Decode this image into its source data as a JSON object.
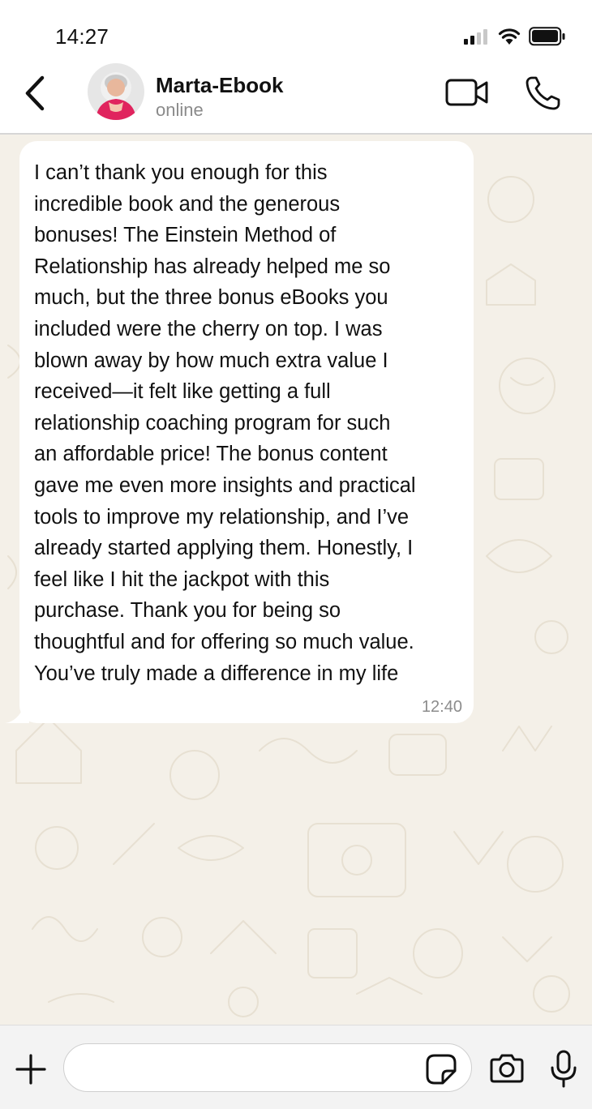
{
  "status_bar": {
    "time": "14:27",
    "icons": [
      "signal-icon",
      "wifi-icon",
      "battery-icon"
    ]
  },
  "header": {
    "back_icon": "chevron-left-icon",
    "contact_name": "Marta-Ebook",
    "contact_status": "online",
    "actions": [
      "video-camera-icon",
      "phone-icon"
    ]
  },
  "chat": {
    "wallpaper_color": "#f4f0e8",
    "messages": [
      {
        "direction": "incoming",
        "text": "I can’t thank you enough for this\nincredible book and the generous\nbonuses! The Einstein Method of\nRelationship has already helped me so\nmuch, but the three bonus eBooks you\nincluded were the cherry on top. I was\nblown away by how much extra value I\nreceived—it felt like getting a full\nrelationship coaching program for such\nan affordable price! The bonus content\ngave me even more insights and practical\ntools to improve my relationship, and I’ve\nalready started applying them. Honestly, I\nfeel like I hit the jackpot with this\npurchase. Thank you for being so\nthoughtful and for offering so much value.\nYou’ve truly made a difference in my life",
        "time": "12:40"
      }
    ]
  },
  "input_bar": {
    "attach_icon": "plus-icon",
    "input_value": "",
    "input_placeholder": "",
    "sticker_icon": "sticker-icon",
    "camera_icon": "camera-icon",
    "mic_icon": "microphone-icon"
  }
}
